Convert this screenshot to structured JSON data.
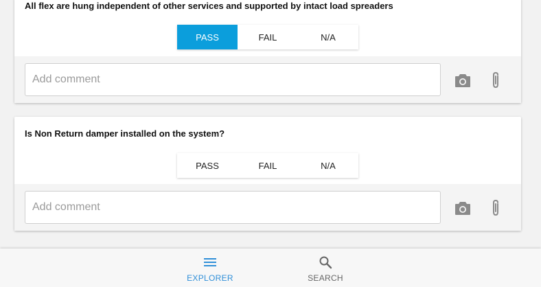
{
  "checklist": [
    {
      "question": "All flex are hung independent of other services and supported by intact load spreaders",
      "options": [
        "PASS",
        "FAIL",
        "N/A"
      ],
      "selected": "PASS",
      "comment_placeholder": "Add comment",
      "comment_value": ""
    },
    {
      "question": "Is Non Return damper installed on the system?",
      "options": [
        "PASS",
        "FAIL",
        "N/A"
      ],
      "selected": "",
      "comment_placeholder": "Add comment",
      "comment_value": ""
    }
  ],
  "bottom_nav": {
    "explorer_label": "EXPLORER",
    "search_label": "SEARCH",
    "active": "EXPLORER"
  },
  "colors": {
    "accent": "#0b9edc",
    "nav_active": "#2f8fd8",
    "icon_gray": "#8a8a8a"
  },
  "icons": [
    "camera-icon",
    "paperclip-icon",
    "menu-icon",
    "search-icon"
  ]
}
